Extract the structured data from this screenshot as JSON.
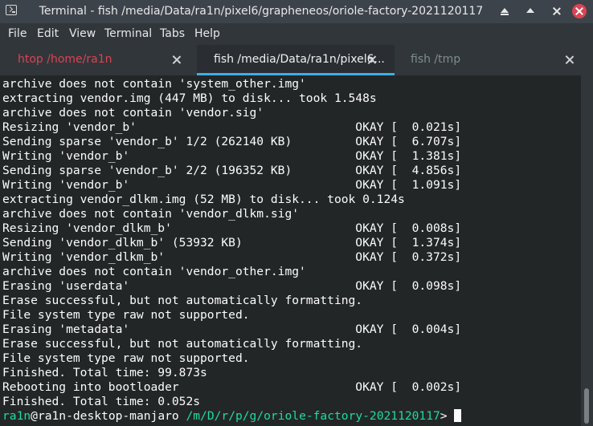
{
  "window": {
    "title": "Terminal - fish /media/Data/ra1n/pixel6/grapheneos/oriole-factory-2021120117",
    "app_icon": "terminal-icon",
    "controls": [
      "minimize-icon",
      "maximize-icon",
      "restore-icon",
      "close-icon"
    ]
  },
  "menu": [
    "File",
    "Edit",
    "View",
    "Terminal",
    "Tabs",
    "Help"
  ],
  "tabs": [
    {
      "label": "htop /home/ra1n",
      "color": "#da4453"
    },
    {
      "label": "fish /media/Data/ra1n/pixel6...",
      "color": "#eff0f1"
    },
    {
      "label": "fish /tmp",
      "color": "#7f8c8d"
    }
  ],
  "colors": {
    "accent": "#3daee9",
    "prompt": "#1cdc9a",
    "terminal_bg": "#232627",
    "terminal_fg": "#fcfcfc"
  },
  "terminal": {
    "lines": [
      "archive does not contain 'system_other.img'",
      "extracting vendor.img (447 MB) to disk... took 1.548s",
      "archive does not contain 'vendor.sig'",
      "Resizing 'vendor_b'                               OKAY [  0.021s]",
      "Sending sparse 'vendor_b' 1/2 (262140 KB)         OKAY [  6.707s]",
      "Writing 'vendor_b'                                OKAY [  1.381s]",
      "Sending sparse 'vendor_b' 2/2 (196352 KB)         OKAY [  4.856s]",
      "Writing 'vendor_b'                                OKAY [  1.091s]",
      "extracting vendor_dlkm.img (52 MB) to disk... took 0.124s",
      "archive does not contain 'vendor_dlkm.sig'",
      "Resizing 'vendor_dlkm_b'                          OKAY [  0.008s]",
      "Sending 'vendor_dlkm_b' (53932 KB)                OKAY [  1.374s]",
      "Writing 'vendor_dlkm_b'                           OKAY [  0.372s]",
      "archive does not contain 'vendor_other.img'",
      "Erasing 'userdata'                                OKAY [  0.098s]",
      "Erase successful, but not automatically formatting.",
      "File system type raw not supported.",
      "Erasing 'metadata'                                OKAY [  0.004s]",
      "Erase successful, but not automatically formatting.",
      "File system type raw not supported.",
      "Finished. Total time: 99.873s",
      "Rebooting into bootloader                         OKAY [  0.002s]",
      "Finished. Total time: 0.052s"
    ],
    "prompt": {
      "user": "ra1n",
      "at": "@",
      "host": "ra1n-desktop-manjaro",
      "path": "/m/D/r/p/g/oriole-factory-2021120117",
      "symbol": "> "
    }
  }
}
